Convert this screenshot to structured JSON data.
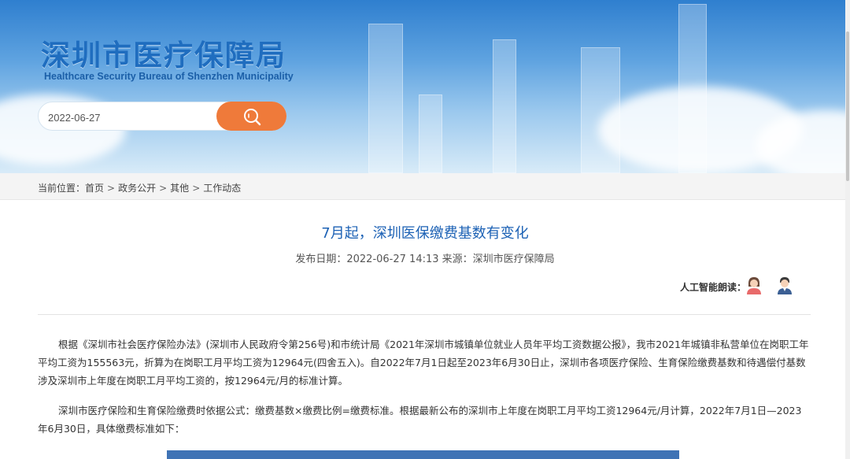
{
  "header": {
    "org_name_cn": "深圳市医疗保障局",
    "org_name_en": "Healthcare Security Bureau of Shenzhen Municipality",
    "search": {
      "value": "2022-06-27",
      "button_icon": "search-icon"
    }
  },
  "breadcrumb": {
    "prefix": "当前位置：",
    "items": [
      "首页",
      "政务公开",
      "其他",
      "工作动态"
    ],
    "separator": ">"
  },
  "article": {
    "title": "7月起，深圳医保缴费基数有变化",
    "meta": "发布日期：2022-06-27 14:13 来源：深圳市医疗保障局",
    "ai_read_label": "人工智能朗读：",
    "voices": [
      "female-voice-avatar-icon",
      "male-voice-avatar-icon"
    ],
    "paragraphs": [
      "根据《深圳市社会医疗保险办法》(深圳市人民政府令第256号)和市统计局《2021年深圳市城镇单位就业人员年平均工资数据公报》，我市2021年城镇非私营单位在岗职工年平均工资为155563元，折算为在岗职工月平均工资为12964元(四舍五入)。自2022年7月1日起至2023年6月30日止，深圳市各项医疗保险、生育保险缴费基数和待遇偿付基数涉及深圳市上年度在岗职工月平均工资的，按12964元/月的标准计算。",
      "深圳市医疗保险和生育保险缴费时依据公式：缴费基数×缴费比例=缴费标准。根据最新公布的深圳市上年度在岗职工月平均工资12964元/月计算，2022年7月1日—2023年6月30日，具体缴费标准如下："
    ]
  },
  "colors": {
    "title_blue": "#1d62b5",
    "search_orange": "#ef7a3a",
    "table_header_blue": "#3f73b5"
  }
}
